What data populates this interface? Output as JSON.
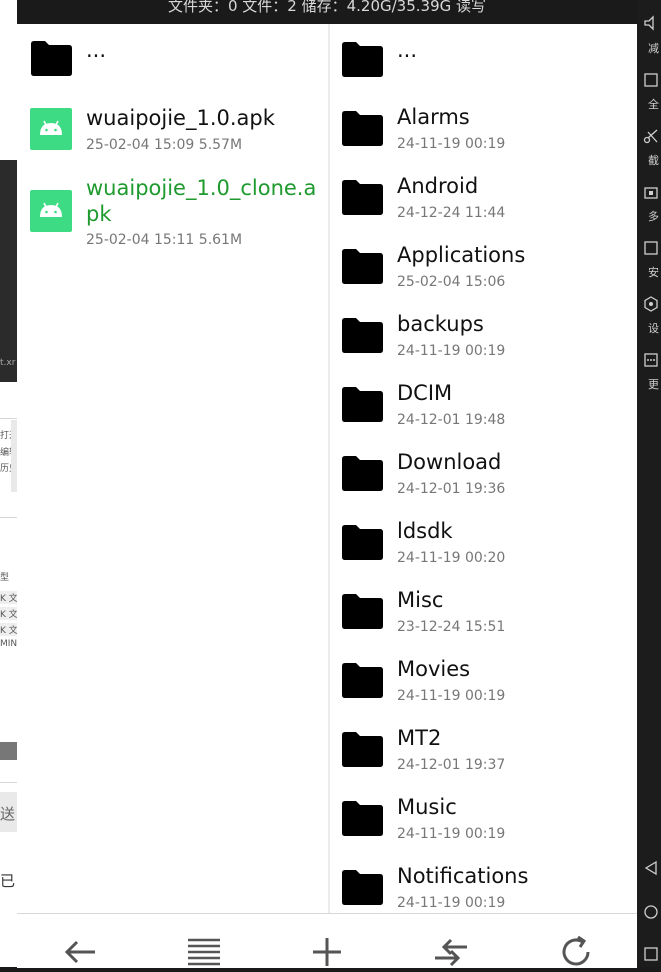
{
  "status_bar": {
    "text": "文件夹：0 文件：2  储存：4.20G/35.39G  读写"
  },
  "left_pane": {
    "items": [
      {
        "name": "...",
        "meta": "",
        "type": "folder"
      },
      {
        "name": "wuaipojie_1.0.apk",
        "meta": "25-02-04 15:09  5.57M",
        "type": "apk"
      },
      {
        "name": "wuaipojie_1.0_clone.apk",
        "meta": "25-02-04 15:11  5.61M",
        "type": "apk",
        "highlight": true
      }
    ]
  },
  "right_pane": {
    "items": [
      {
        "name": "...",
        "meta": ""
      },
      {
        "name": "Alarms",
        "meta": "24-11-19 00:19"
      },
      {
        "name": "Android",
        "meta": "24-12-24 11:44"
      },
      {
        "name": "Applications",
        "meta": "25-02-04 15:06"
      },
      {
        "name": "backups",
        "meta": "24-11-19 00:19"
      },
      {
        "name": "DCIM",
        "meta": "24-12-01 19:48"
      },
      {
        "name": "Download",
        "meta": "24-12-01 19:36"
      },
      {
        "name": "ldsdk",
        "meta": "24-11-19 00:20"
      },
      {
        "name": "Misc",
        "meta": "23-12-24 15:51"
      },
      {
        "name": "Movies",
        "meta": "24-11-19 00:19"
      },
      {
        "name": "MT2",
        "meta": "24-12-01 19:37"
      },
      {
        "name": "Music",
        "meta": "24-11-19 00:19"
      },
      {
        "name": "Notifications",
        "meta": "24-11-19 00:19"
      }
    ]
  },
  "toolbar": {
    "buttons": [
      "back-arrow-icon",
      "menu-lines-icon",
      "plus-icon",
      "swap-arrows-icon",
      "refresh-icon"
    ]
  },
  "left_strip": {
    "text_lines": [
      "t.xr",
      "打开",
      "编辑",
      "历史记",
      "型",
      "K 文",
      "K 文",
      "K 文",
      "MIND",
      "送",
      "已"
    ]
  },
  "side_bar": {
    "labels": [
      "减",
      "全",
      "截",
      "多",
      "安",
      "设",
      "更"
    ]
  },
  "colors": {
    "apk_green": "#3ddc84",
    "highlight_text": "#1e9a2f",
    "folder": "#000000"
  }
}
